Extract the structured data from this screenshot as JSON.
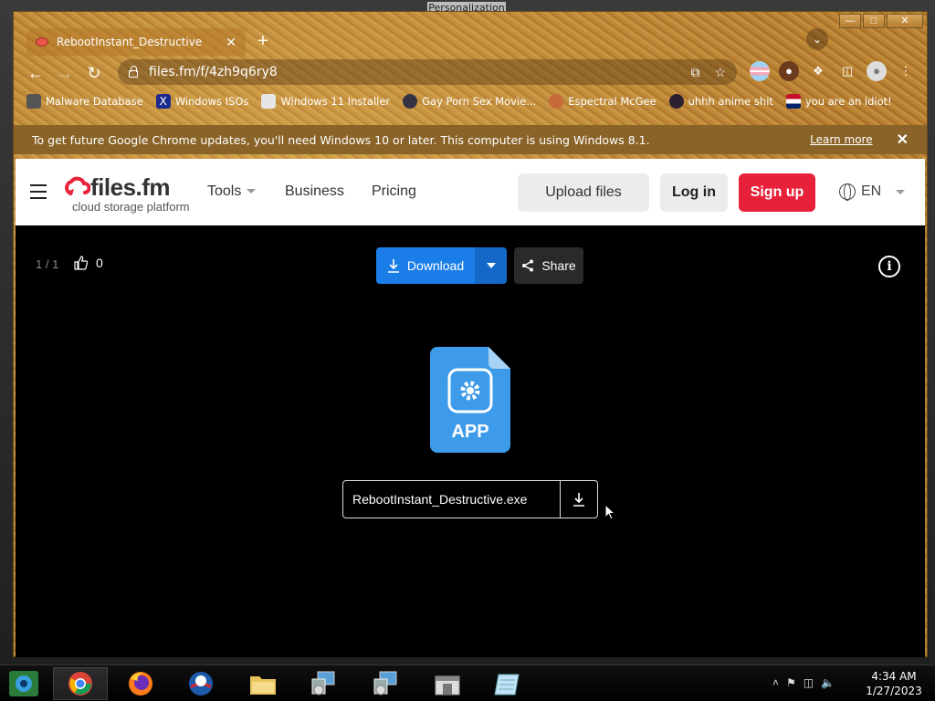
{
  "desktop": {
    "window_title": "Personalization"
  },
  "browser": {
    "tab_title": "RebootInstant_Destructive",
    "url": "files.fm/f/4zh9q6ry8",
    "bookmarks": [
      {
        "label": "Malware Database"
      },
      {
        "label": "Windows ISOs"
      },
      {
        "label": "Windows 11 Installer"
      },
      {
        "label": "Gay Porn Sex Movie..."
      },
      {
        "label": "Espectral McGee"
      },
      {
        "label": "uhhh anime shit"
      },
      {
        "label": "you are an idiot!"
      }
    ],
    "infobar": {
      "message": "To get future Google Chrome updates, you'll need Windows 10 or later. This computer is using Windows 8.1.",
      "learn_more": "Learn more"
    }
  },
  "site": {
    "logo_text": "files.fm",
    "logo_tagline": "cloud storage platform",
    "nav": {
      "tools": "Tools",
      "business": "Business",
      "pricing": "Pricing"
    },
    "upload_label": "Upload files",
    "login_label": "Log in",
    "signup_label": "Sign up",
    "language": "EN",
    "accent": "#e8213a"
  },
  "viewer": {
    "counter": "1 / 1",
    "likes": "0",
    "download_label": "Download",
    "share_label": "Share",
    "file_type": "APP",
    "file_name": "RebootInstant_Destructive.exe",
    "download_color": "#1a7de8"
  },
  "taskbar": {
    "time": "4:34 AM",
    "date": "1/27/2023"
  }
}
